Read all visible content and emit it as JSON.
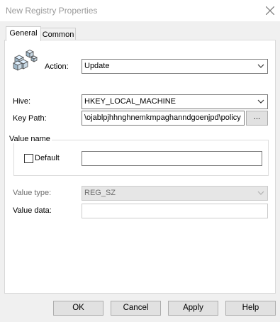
{
  "window": {
    "title": "New Registry Properties"
  },
  "tabs": [
    {
      "label": "General",
      "active": true
    },
    {
      "label": "Common",
      "active": false
    }
  ],
  "general": {
    "icon": "registry-cubes-icon",
    "action_label": "Action:",
    "action_value": "Update",
    "hive_label": "Hive:",
    "hive_value": "HKEY_LOCAL_MACHINE",
    "keypath_label": "Key Path:",
    "keypath_value": "\\ojablpjhhnghnemkmpaghanndgoenjpd\\policy",
    "browse_label": "...",
    "value_name_group": "Value name",
    "default_label": "Default",
    "default_checked": false,
    "value_name_value": "",
    "value_type_label": "Value type:",
    "value_type_value": "REG_SZ",
    "value_data_label": "Value data:",
    "value_data_value": ""
  },
  "buttons": {
    "ok": "OK",
    "cancel": "Cancel",
    "apply": "Apply",
    "help": "Help"
  },
  "colors": {
    "title_text": "#999999",
    "border": "#7a7a7a",
    "button_bg": "#e1e1e1",
    "panel_bg": "#ffffff",
    "dialog_bg": "#f0f0f0"
  }
}
